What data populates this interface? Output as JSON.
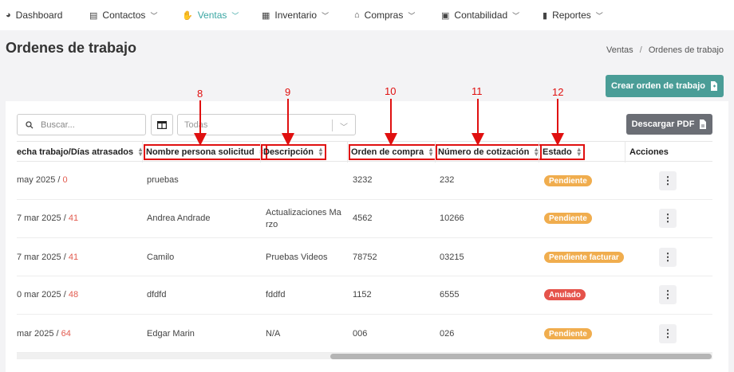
{
  "nav": {
    "items": [
      {
        "label": "Dashboard",
        "icon": "dashboard-icon",
        "glyph": "◕",
        "active": false
      },
      {
        "label": "Contactos",
        "icon": "contact-card-icon",
        "glyph": "▤",
        "active": false
      },
      {
        "label": "Ventas",
        "icon": "hand-money-icon",
        "glyph": "✋",
        "active": true
      },
      {
        "label": "Inventario",
        "icon": "boxes-icon",
        "glyph": "▦",
        "active": false
      },
      {
        "label": "Compras",
        "icon": "store-icon",
        "glyph": "⌂",
        "active": false
      },
      {
        "label": "Contabilidad",
        "icon": "calculator-icon",
        "glyph": "▣",
        "active": false
      },
      {
        "label": "Reportes",
        "icon": "bar-chart-icon",
        "glyph": "▮",
        "active": false
      }
    ],
    "accent": "#3aa6a3"
  },
  "page": {
    "title": "Ordenes de trabajo",
    "breadcrumb": {
      "parent": "Ventas",
      "separator": "/",
      "current": "Ordenes de trabajo"
    }
  },
  "toolbar": {
    "create_label": "Crear orden de trabajo",
    "search_placeholder": "Buscar...",
    "select_value": "Todas",
    "pdf_label": "Descargar PDF",
    "create_color": "#4a9d97",
    "pdf_color": "#6b6e75"
  },
  "table": {
    "columns": [
      {
        "label": "echa trabajo/Días atrasados",
        "annotation": ""
      },
      {
        "label": "Nombre persona solicitud",
        "annotation": "8"
      },
      {
        "label": "Descripción",
        "annotation": "9"
      },
      {
        "label": "Orden de compra",
        "annotation": "10"
      },
      {
        "label": "Número de cotización",
        "annotation": "11"
      },
      {
        "label": "Estado",
        "annotation": "12"
      },
      {
        "label": "Acciones",
        "annotation": ""
      }
    ],
    "rows": [
      {
        "date": "may 2025 /",
        "days": "0",
        "name": "pruebas",
        "desc": [
          "",
          ""
        ],
        "oc": "3232",
        "quote": "232",
        "status": "Pendiente",
        "status_kind": "pending"
      },
      {
        "date": "7 mar 2025 /",
        "days": "41",
        "name": "Andrea Andrade",
        "desc": [
          "Actualizaciones Ma",
          "rzo"
        ],
        "oc": "4562",
        "quote": "10266",
        "status": "Pendiente",
        "status_kind": "pending"
      },
      {
        "date": "7 mar 2025 /",
        "days": "41",
        "name": "Camilo",
        "desc": [
          "Pruebas Videos",
          ""
        ],
        "oc": "78752",
        "quote": "03215",
        "status": "Pendiente facturar",
        "status_kind": "pending"
      },
      {
        "date": "0 mar 2025 /",
        "days": "48",
        "name": "dfdfd",
        "desc": [
          "fddfd",
          ""
        ],
        "oc": "1152",
        "quote": "6555",
        "status": "Anulado",
        "status_kind": "void"
      },
      {
        "date": "mar 2025 /",
        "days": "64",
        "name": "Edgar Marin",
        "desc": [
          "N/A",
          ""
        ],
        "oc": "006",
        "quote": "026",
        "status": "Pendiente",
        "status_kind": "pending"
      }
    ],
    "action_icon": "kebab-menu-icon",
    "status_colors": {
      "pending": "#f0ad4e",
      "void": "#e5534b"
    },
    "late_color": "#e25b4f"
  },
  "annotations": {
    "color": "#e01010"
  }
}
